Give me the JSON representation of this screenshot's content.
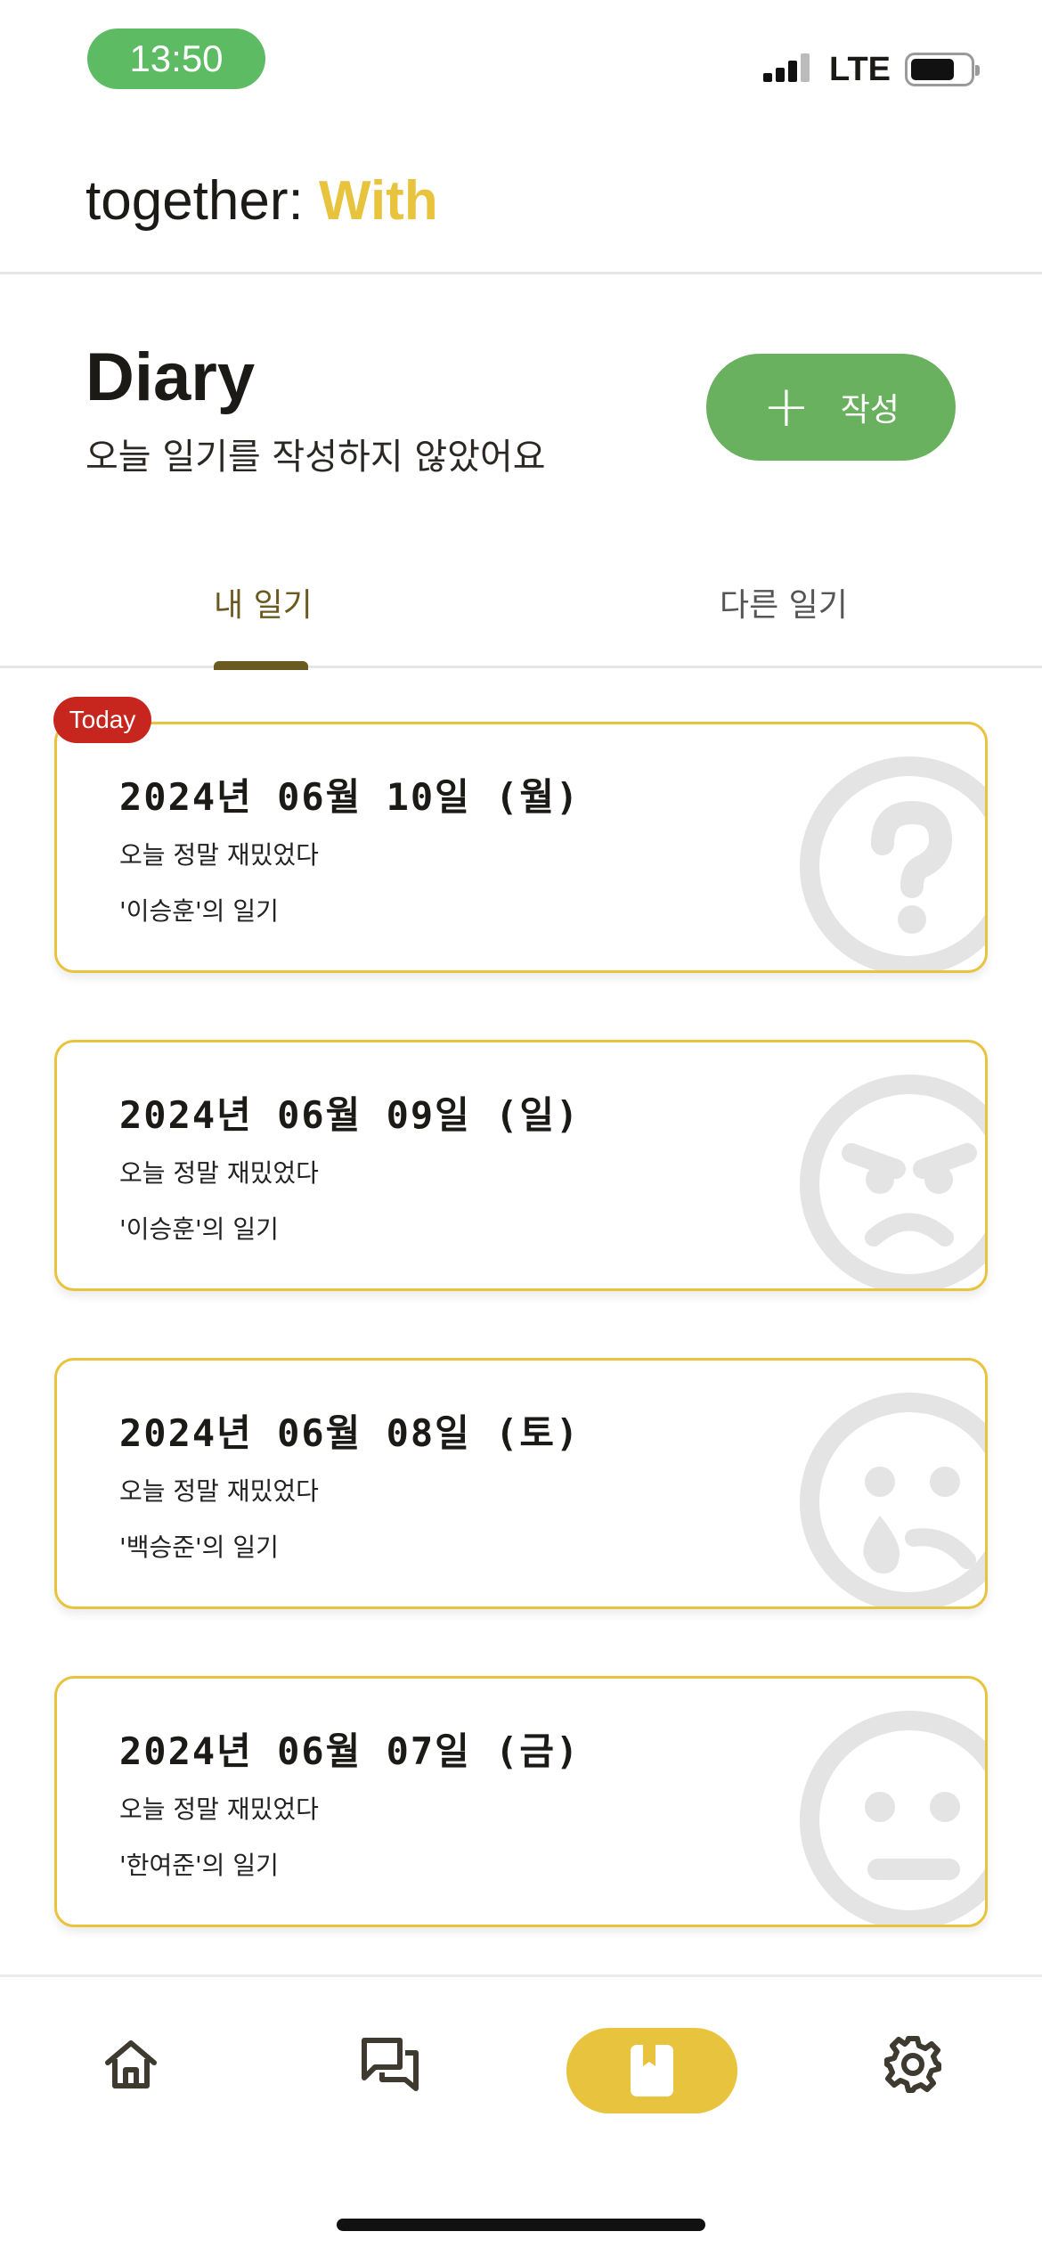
{
  "status": {
    "time": "13:50",
    "network": "LTE"
  },
  "header": {
    "brand_prefix": "together: ",
    "brand_accent": "With",
    "accent_color": "#e8c33e"
  },
  "diary": {
    "title": "Diary",
    "subtitle": "오늘 일기를 작성하지 않았어요",
    "write_button_label": "작성",
    "write_button_color": "#69b15f"
  },
  "tabs": [
    {
      "label": "내 일기",
      "active": true
    },
    {
      "label": "다른 일기",
      "active": false
    }
  ],
  "today_badge": "Today",
  "entries": [
    {
      "date": "2024년 06월 10일 (월)",
      "text": "오늘 정말 재밌었다",
      "author": "'이승훈'의 일기",
      "mood_icon": "question-face-icon"
    },
    {
      "date": "2024년 06월 09일 (일)",
      "text": "오늘 정말 재밌었다",
      "author": "'이승훈'의 일기",
      "mood_icon": "angry-face-icon"
    },
    {
      "date": "2024년 06월 08일 (토)",
      "text": "오늘 정말 재밌었다",
      "author": "'백승준'의 일기",
      "mood_icon": "crying-face-icon"
    },
    {
      "date": "2024년 06월 07일 (금)",
      "text": "오늘 정말 재밌었다",
      "author": "'한여준'의 일기",
      "mood_icon": "neutral-face-icon"
    }
  ],
  "nav": [
    {
      "icon": "home-icon",
      "active": false
    },
    {
      "icon": "chat-icon",
      "active": false
    },
    {
      "icon": "diary-icon",
      "active": true
    },
    {
      "icon": "gear-icon",
      "active": false
    }
  ]
}
